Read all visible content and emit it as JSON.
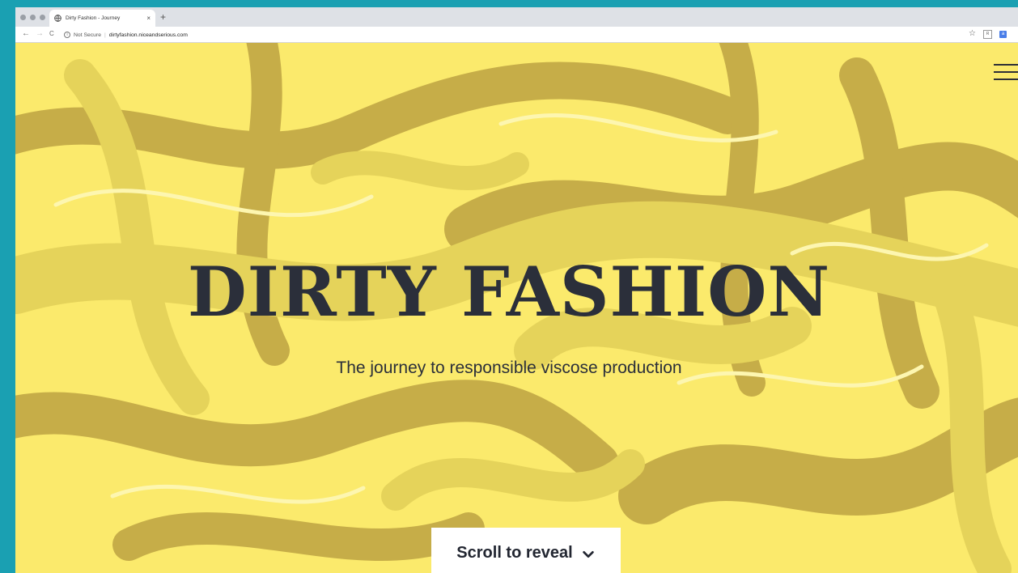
{
  "browser": {
    "tab_title": "Dirty Fashion - Journey",
    "tab_close": "×",
    "new_tab": "+",
    "security_label": "Not Secure",
    "separator": "|",
    "url": "dirtyfashion.niceandserious.com",
    "back": "←",
    "forward": "→",
    "reload": "C",
    "info_glyph": "i",
    "star": "☆",
    "ext1": "R",
    "ext2": "a"
  },
  "hero": {
    "title": "DIRTY FASHION",
    "subtitle": "The journey to responsible viscose production",
    "scroll_label": "Scroll to reveal",
    "menu_icon": "hamburger-icon"
  },
  "colors": {
    "background": "#1aa0b2",
    "hero_light": "#fbea6c",
    "hero_mid": "#e5d35a",
    "hero_dark": "#c6ad48",
    "text_dark": "#2b2f3a",
    "button_bg": "#ffffff"
  }
}
